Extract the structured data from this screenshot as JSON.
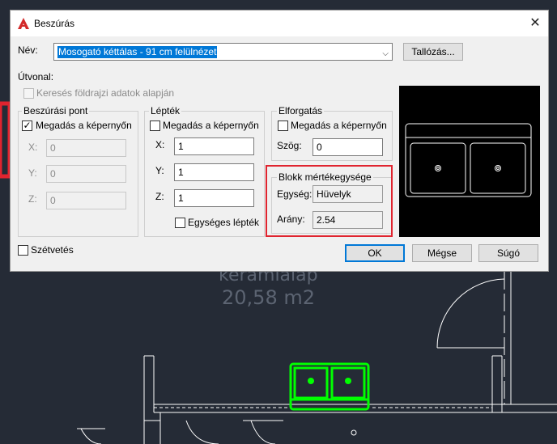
{
  "background": {
    "room_name": "kerámialap",
    "room_area": "20,58  m2"
  },
  "dialog": {
    "title": "Beszúrás",
    "close_symbol": "✕",
    "name": {
      "label": "Név:",
      "value": "Mosogató kéttálas - 91 cm felülnézet",
      "browse_button": "Tallózás..."
    },
    "path_label": "Útvonal:",
    "geo_checkbox": {
      "label": "Keresés földrajzi adatok alapján",
      "checked": false,
      "enabled": false
    },
    "insertion_point": {
      "title": "Beszúrási pont",
      "specify_on_screen": {
        "label": "Megadás a képernyőn",
        "checked": true
      },
      "x": {
        "label": "X:",
        "value": "0"
      },
      "y": {
        "label": "Y:",
        "value": "0"
      },
      "z": {
        "label": "Z:",
        "value": "0"
      }
    },
    "scale": {
      "title": "Lépték",
      "specify_on_screen": {
        "label": "Megadás a képernyőn",
        "checked": false
      },
      "x": {
        "label": "X:",
        "value": "1"
      },
      "y": {
        "label": "Y:",
        "value": "1"
      },
      "z": {
        "label": "Z:",
        "value": "1"
      },
      "uniform": {
        "label": "Egységes lépték",
        "checked": false
      }
    },
    "rotation": {
      "title": "Elforgatás",
      "specify_on_screen": {
        "label": "Megadás a képernyőn",
        "checked": false
      },
      "angle": {
        "label": "Szög:",
        "value": "0"
      }
    },
    "block_unit": {
      "title": "Blokk mértékegysége",
      "unit": {
        "label": "Egység:",
        "value": "Hüvelyk"
      },
      "factor": {
        "label": "Arány:",
        "value": "2.54"
      }
    },
    "explode": {
      "label": "Szétvetés",
      "checked": false
    },
    "buttons": {
      "ok": "OK",
      "cancel": "Mégse",
      "help": "Súgó"
    }
  },
  "colors": {
    "accent": "#0078d7",
    "highlight": "#e0242f",
    "cad_background": "#252b36",
    "cad_lines": "#ffffff",
    "selected_block": "#00ff00"
  }
}
